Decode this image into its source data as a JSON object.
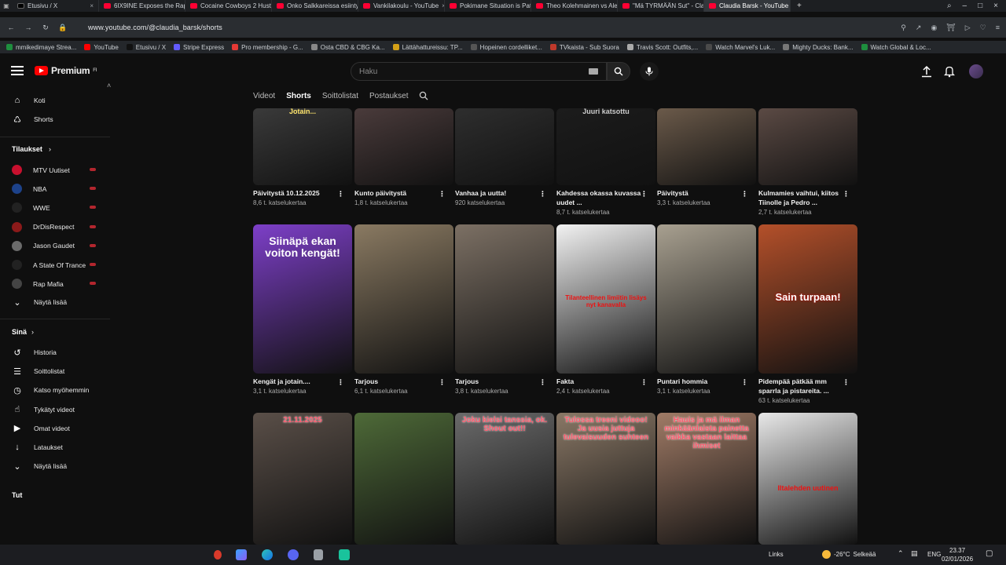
{
  "browser": {
    "tabs": [
      {
        "title": "Etusivu / X",
        "favicon": "x-icon"
      },
      {
        "title": "6IX9INE Exposes the Rap",
        "favicon": "youtube-icon"
      },
      {
        "title": "Cocaine Cowboys 2 Husti",
        "favicon": "youtube-icon"
      },
      {
        "title": "Onko Salkkareissa esiinty",
        "favicon": "youtube-icon"
      },
      {
        "title": "Vankilakoulu - YouTube",
        "favicon": "youtube-icon"
      },
      {
        "title": "Pokimane Situation is Pat",
        "favicon": "youtube-icon"
      },
      {
        "title": "Theo Kolehmainen vs Alei",
        "favicon": "youtube-icon"
      },
      {
        "title": "\"Mä TYRMÄÄN Sut\" - Cla",
        "favicon": "youtube-icon"
      },
      {
        "title": "Claudia Barsk - YouTube",
        "favicon": "youtube-icon",
        "active": true
      }
    ],
    "url": "www.youtube.com/@claudia_barsk/shorts",
    "bookmarks": [
      "mmikedimaye Strea...",
      "YouTube",
      "Etusivu / X",
      "Stripe Express",
      "Pro membership - G...",
      "Osta CBD & CBG Ka...",
      "Lättähattureissu: TP...",
      "Hopeinen cordelliket...",
      "TVkaista - Sub Suora",
      "Travis Scott: Outfits,...",
      "Watch Marvel's Luk...",
      "Mighty Ducks: Bank...",
      "Watch Global & Loc..."
    ]
  },
  "header": {
    "brand": "Premium",
    "brand_sup": "FI",
    "search_placeholder": "Haku"
  },
  "channel_tabs": [
    "Videot",
    "Shorts",
    "Soittolistat",
    "Postaukset"
  ],
  "sidebar": {
    "top": [
      {
        "label": "Koti",
        "icon": "home-icon"
      },
      {
        "label": "Shorts",
        "icon": "shorts-icon"
      }
    ],
    "subs_heading": "Tilaukset",
    "subs": [
      {
        "label": "MTV Uutiset",
        "color": "#c8102e"
      },
      {
        "label": "NBA",
        "color": "#1d428a"
      },
      {
        "label": "WWE",
        "color": "#222222"
      },
      {
        "label": "DrDisRespect",
        "color": "#8b1a1a"
      },
      {
        "label": "Jason Gaudet",
        "color": "#6b6b6b"
      },
      {
        "label": "A State Of Trance",
        "color": "#222222"
      },
      {
        "label": "Rap Mafia",
        "color": "#444444"
      }
    ],
    "show_more": "Näytä lisää",
    "you_heading": "Sinä",
    "you_items": [
      {
        "label": "Historia",
        "icon": "history-icon"
      },
      {
        "label": "Soittolistat",
        "icon": "playlist-icon"
      },
      {
        "label": "Katso myöhemmin",
        "icon": "clock-icon"
      },
      {
        "label": "Tykätyt videot",
        "icon": "like-icon"
      },
      {
        "label": "Omat videot",
        "icon": "video-icon"
      },
      {
        "label": "Lataukset",
        "icon": "download-icon"
      }
    ],
    "show_more_2": "Näytä lisää",
    "partial": "Tut"
  },
  "shorts": [
    [
      {
        "title": "Päivitystä 10.12.2025",
        "views": "8,6 t. katselukertaa",
        "overlay": "Jotain...",
        "bg": "#3a3a3a"
      },
      {
        "title": "Kunto päivitystä",
        "views": "1,8 t. katselukertaa",
        "overlay": "",
        "bg": "#4a3b3b"
      },
      {
        "title": "Vanhaa ja uutta!",
        "views": "920 katselukertaa",
        "overlay": "",
        "bg": "#2e2e2e"
      },
      {
        "title": "Kahdessa okassa kuvassa uudet ...",
        "views": "8,7 t. katselukertaa",
        "overlay": "Juuri katsottu",
        "bg": "#1c1c1c"
      },
      {
        "title": "Päivitystä",
        "views": "3,3 t. katselukertaa",
        "overlay": "",
        "bg": "#6b5a4a"
      },
      {
        "title": "Kulmamies vaihtui, kiitos Tiinolle ja Pedro ...",
        "views": "2,7 t. katselukertaa",
        "overlay": "",
        "bg": "#5b4a44"
      }
    ],
    [
      {
        "title": "Kengät ja jotain....",
        "views": "3,1 t. katselukertaa",
        "overlay": "Siinäpä ekan voiton kengät!",
        "bg": "#7d3fc8"
      },
      {
        "title": "Tarjous",
        "views": "6,1 t. katselukertaa",
        "overlay": "",
        "bg": "#8a7a62"
      },
      {
        "title": "Tarjous",
        "views": "3,8 t. katselukertaa",
        "overlay": "",
        "bg": "#7c7064"
      },
      {
        "title": "Fakta",
        "views": "2,4 t. katselukertaa",
        "overlay": "Tilanteellinen limiitin lisäys nyt kanavalla",
        "bg": "#f2f2f2"
      },
      {
        "title": "Puntari hommia",
        "views": "3,1 t. katselukertaa",
        "overlay": "",
        "bg": "#a8a090"
      },
      {
        "title": "Pidempää pätkää mm sparrla ja pistareita. ...",
        "views": "63 t. katselukertaa",
        "overlay": "Sain turpaan!",
        "bg": "#b4502a"
      }
    ],
    [
      {
        "title": "",
        "views": "",
        "overlay": "21.11.2025",
        "bg": "#5a4f48"
      },
      {
        "title": "",
        "views": "",
        "overlay": "",
        "bg": "#4e6a38"
      },
      {
        "title": "",
        "views": "",
        "overlay": "Joku kielsi tanssia, ok. Shout out!!",
        "bg": "#6a6a6a"
      },
      {
        "title": "",
        "views": "",
        "overlay": "Tulossa treeni videoo! Ja uusia juttuja tulevaisuuden suhteen",
        "bg": "#8a7866"
      },
      {
        "title": "",
        "views": "",
        "overlay": "Hauis ja mä ilman minkäänlaista painetta vaikka vastaan laittaa ihmiset",
        "bg": "#a07b66"
      },
      {
        "title": "",
        "views": "",
        "overlay": "Iltalehden uutinen",
        "bg": "#e8e8e8"
      }
    ]
  ],
  "taskbar": {
    "links": "Links",
    "temp": "-26°C",
    "weather": "Selkeää",
    "lang": "ENG",
    "time": "23.37",
    "date": "02/01/2026"
  }
}
